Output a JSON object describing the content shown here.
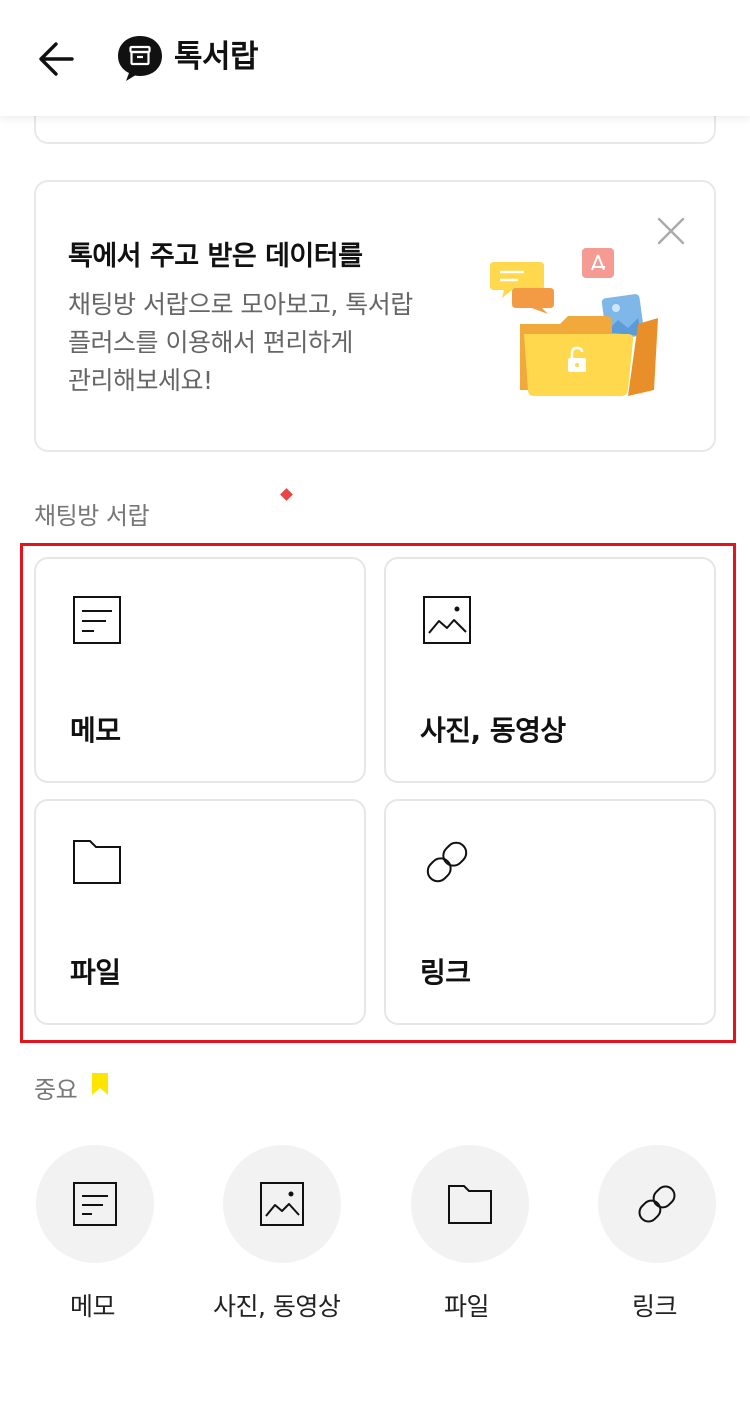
{
  "header": {
    "title": "톡서랍"
  },
  "promo": {
    "title": "톡에서 주고 받은 데이터를",
    "description": "채팅방 서랍으로 모아보고, 톡서랍\n플러스를 이용해서 편리하게\n관리해보세요!"
  },
  "chat_drawer": {
    "label": "채팅방 서랍",
    "tiles": [
      {
        "label": "메모",
        "icon": "memo-icon"
      },
      {
        "label": "사진, 동영상",
        "icon": "photo-icon"
      },
      {
        "label": "파일",
        "icon": "folder-icon"
      },
      {
        "label": "링크",
        "icon": "link-icon"
      }
    ]
  },
  "important": {
    "label": "중요",
    "items": [
      {
        "label": "메모",
        "icon": "memo-icon"
      },
      {
        "label": "사진, 동영상",
        "icon": "photo-icon"
      },
      {
        "label": "파일",
        "icon": "folder-icon"
      },
      {
        "label": "링크",
        "icon": "link-icon"
      }
    ]
  },
  "colors": {
    "accent_yellow": "#FEE500",
    "highlight_red": "#E3141C",
    "text_primary": "#111111",
    "text_secondary": "#666666",
    "circle_bg": "#F2F2F2"
  }
}
